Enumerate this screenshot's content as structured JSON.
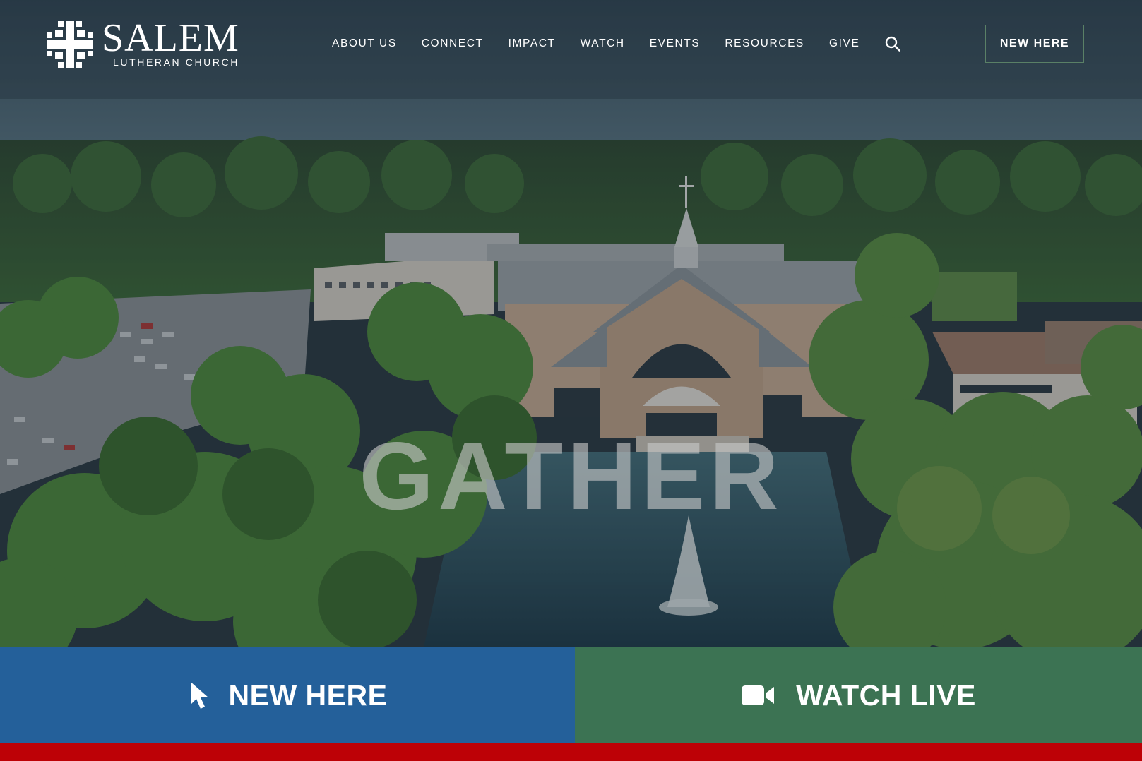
{
  "brand": {
    "name": "SALEM",
    "subtitle": "LUTHERAN CHURCH",
    "logo_icon": "cross-grid-logo-icon"
  },
  "nav": {
    "items": [
      {
        "label": "ABOUT US"
      },
      {
        "label": "CONNECT"
      },
      {
        "label": "IMPACT"
      },
      {
        "label": "WATCH"
      },
      {
        "label": "EVENTS"
      },
      {
        "label": "RESOURCES"
      },
      {
        "label": "GIVE"
      }
    ],
    "search_icon": "search-icon",
    "cta_label": "NEW HERE"
  },
  "hero": {
    "title": "GATHER",
    "background": "aerial-church-campus-with-pond-fountain"
  },
  "cta_bar": {
    "new_here": {
      "label": "NEW HERE",
      "icon": "pointer-cursor-icon",
      "color": "#24609a"
    },
    "watch_live": {
      "label": "WATCH LIVE",
      "icon": "video-camera-icon",
      "color": "#3c7353"
    }
  },
  "colors": {
    "accent_red": "#bd0106",
    "button_border": "#5a8066"
  }
}
